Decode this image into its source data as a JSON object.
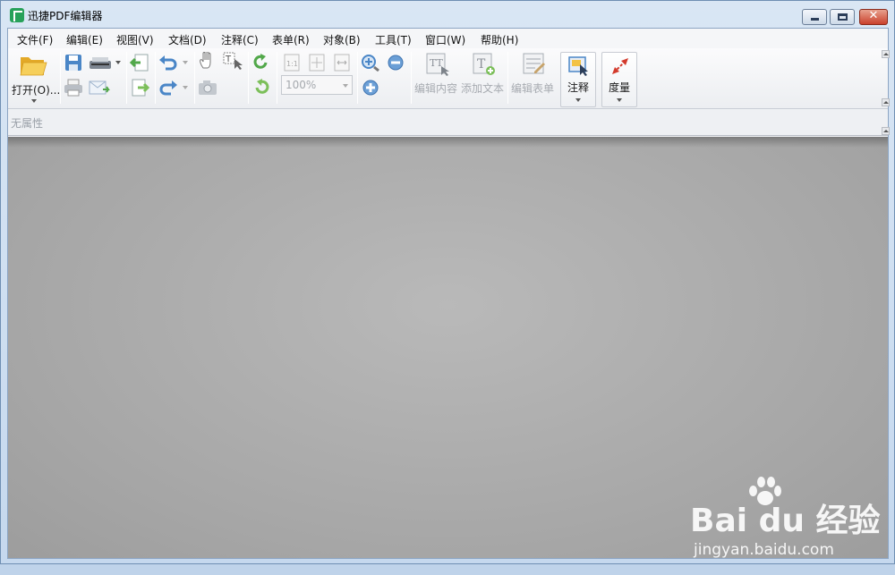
{
  "window": {
    "title": "迅捷PDF编辑器",
    "minimize_glyph": "",
    "close_glyph": "✕"
  },
  "menu": {
    "items": [
      {
        "label": "文件(F)"
      },
      {
        "label": "编辑(E)"
      },
      {
        "label": "视图(V)"
      },
      {
        "label": "文档(D)"
      },
      {
        "label": "注释(C)"
      },
      {
        "label": "表单(R)"
      },
      {
        "label": "对象(B)"
      },
      {
        "label": "工具(T)"
      },
      {
        "label": "窗口(W)"
      },
      {
        "label": "帮助(H)"
      }
    ]
  },
  "toolbar": {
    "open_label": "打开(O)...",
    "zoom_value": "100%",
    "edit_content_label": "编辑内容",
    "add_text_label": "添加文本",
    "edit_form_label": "编辑表单",
    "comment_label": "注释",
    "measure_label": "度量"
  },
  "properties": {
    "text": "无属性"
  },
  "watermark": {
    "logo": "Bai du 经验",
    "url": "jingyan.baidu.com"
  },
  "colors": {
    "folder": "#f3c243",
    "accent_blue": "#4a86c7",
    "green": "#52a84a",
    "measure_red": "#d33a2c",
    "disabled": "#a7abb1"
  }
}
